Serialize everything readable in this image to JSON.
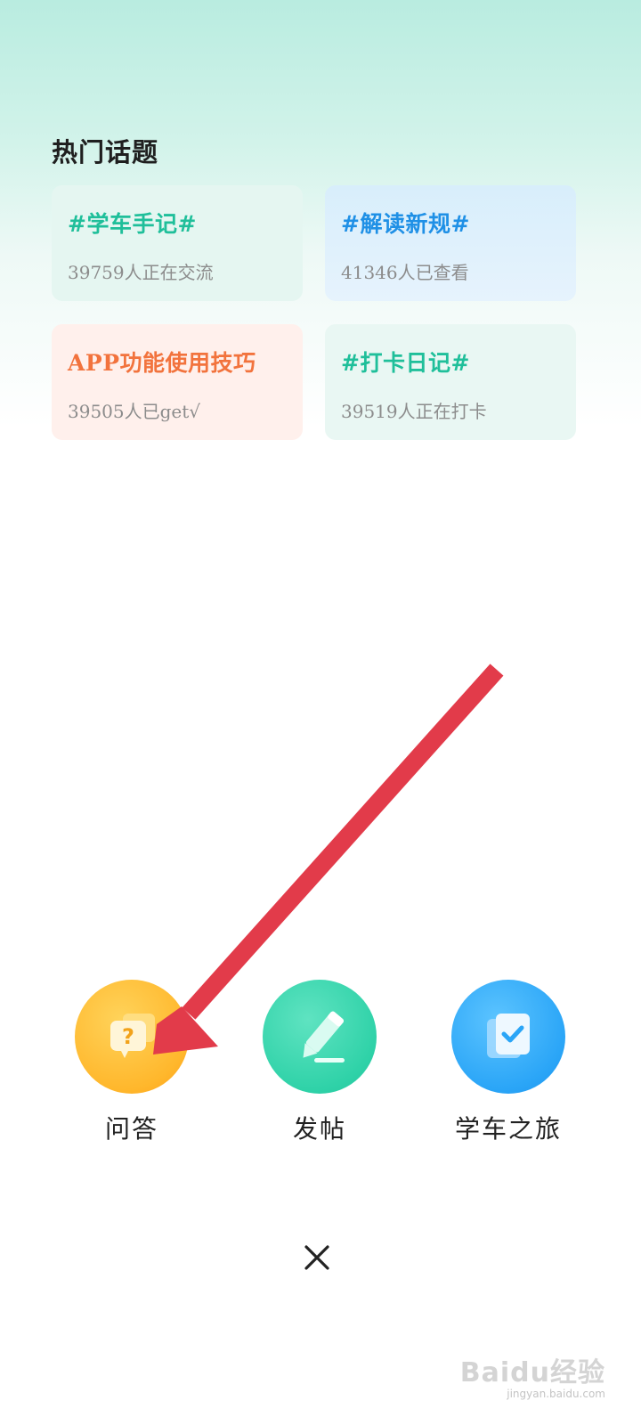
{
  "hot_topics": {
    "title": "热门话题",
    "cards": [
      {
        "title": "#学车手记#",
        "subtitle": "39759人正在交流"
      },
      {
        "title": "#解读新规#",
        "subtitle": "41346人已查看"
      },
      {
        "title": "APP功能使用技巧",
        "subtitle": "39505人已get√"
      },
      {
        "title": "#打卡日记#",
        "subtitle": "39519人正在打卡"
      }
    ]
  },
  "actions": [
    {
      "label": "问答",
      "icon": "question-bubble-icon",
      "color": "#ffb72c"
    },
    {
      "label": "发帖",
      "icon": "pencil-icon",
      "color": "#2fd2a8"
    },
    {
      "label": "学车之旅",
      "icon": "checklist-icon",
      "color": "#2aa5f7"
    }
  ],
  "close_icon": "close-icon",
  "annotation_color": "#e23b4a",
  "watermark": {
    "main": "Baidu经验",
    "sub": "jingyan.baidu.com"
  }
}
